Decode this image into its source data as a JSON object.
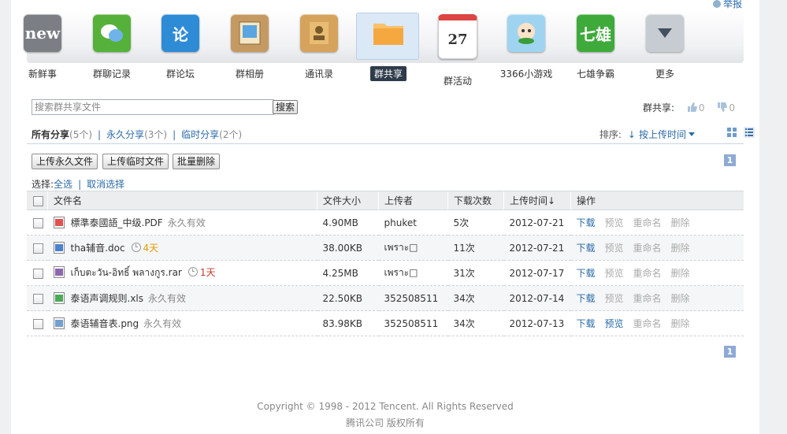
{
  "report_link": "举报",
  "apps": [
    {
      "label": "新鲜事",
      "icon": "new-icon",
      "glyph": "new",
      "color": "#7b7f85"
    },
    {
      "label": "群聊记录",
      "icon": "chat-record-icon",
      "glyph": "",
      "color": "#55b13a"
    },
    {
      "label": "群论坛",
      "icon": "forum-icon",
      "glyph": "论",
      "color": "#2e8bd6"
    },
    {
      "label": "群相册",
      "icon": "album-icon",
      "glyph": "",
      "color": "#c59a62"
    },
    {
      "label": "通讯录",
      "icon": "contacts-icon",
      "glyph": "",
      "color": "#d6a35c"
    },
    {
      "label": "群共享",
      "icon": "folder-icon",
      "glyph": "",
      "color": "#f3a53a"
    },
    {
      "label": "群活动",
      "icon": "calendar-icon",
      "glyph": "27",
      "color": "#ffffff"
    },
    {
      "label": "3366小游戏",
      "icon": "game-3366-icon",
      "glyph": "",
      "color": "#9fd4f0"
    },
    {
      "label": "七雄争霸",
      "icon": "qixiong-icon",
      "glyph": "七雄",
      "color": "#3eaa3a"
    },
    {
      "label": "更多",
      "icon": "more-icon",
      "glyph": "",
      "color": "#c7ccd3"
    }
  ],
  "active_app_index": 5,
  "search": {
    "placeholder": "搜索群共享文件",
    "button": "搜索"
  },
  "rating": {
    "label": "群共享:",
    "up": "0",
    "down": "0"
  },
  "filters": {
    "all_label": "所有分享",
    "all_count": "(5个)",
    "perm_label": "永久分享",
    "perm_count": "(3个)",
    "temp_label": "临时分享",
    "temp_count": "(2个)"
  },
  "sort": {
    "label": "排序:",
    "value": "按上传时间"
  },
  "actions": {
    "upload_permanent": "上传永久文件",
    "upload_temp": "上传临时文件",
    "batch_delete": "批量删除"
  },
  "page_number": "1",
  "select": {
    "label": "选择:",
    "all": "全选",
    "cancel": "取消选择"
  },
  "table": {
    "headers": {
      "name": "文件名",
      "size": "文件大小",
      "uploader": "上传者",
      "downloads": "下载次数",
      "time": "上传时间↓",
      "ops": "操作"
    },
    "ops": {
      "download": "下载",
      "preview": "预览",
      "rename": "重命名",
      "delete": "删除"
    },
    "rows": [
      {
        "name": "標準泰國語_中级.PDF",
        "type": "pdf",
        "status": "永久有效",
        "size": "4.90MB",
        "uploader": "phuket",
        "downloads": "5次",
        "date": "2012-07-21",
        "preview_enabled": false
      },
      {
        "name": "tha辅音.doc",
        "type": "doc",
        "status": "4天",
        "size": "38.00KB",
        "uploader": "เพราะ□",
        "downloads": "11次",
        "date": "2012-07-21",
        "preview_enabled": false
      },
      {
        "name": "เก็บตะวัน-อิทธิ์ พลางกูร.rar",
        "type": "rar",
        "status": "1天",
        "size": "4.25MB",
        "uploader": "เพราะ□",
        "downloads": "31次",
        "date": "2012-07-17",
        "preview_enabled": false
      },
      {
        "name": "泰语声调规则.xls",
        "type": "xls",
        "status": "永久有效",
        "size": "22.50KB",
        "uploader": "352508511",
        "downloads": "34次",
        "date": "2012-07-14",
        "preview_enabled": false
      },
      {
        "name": "泰语辅音表.png",
        "type": "png",
        "status": "永久有效",
        "size": "83.98KB",
        "uploader": "352508511",
        "downloads": "34次",
        "date": "2012-07-13",
        "preview_enabled": true
      }
    ]
  },
  "footer": {
    "copyright": "Copyright © 1998 - 2012 Tencent. All Rights Reserved",
    "company": "腾讯公司 版权所有"
  }
}
